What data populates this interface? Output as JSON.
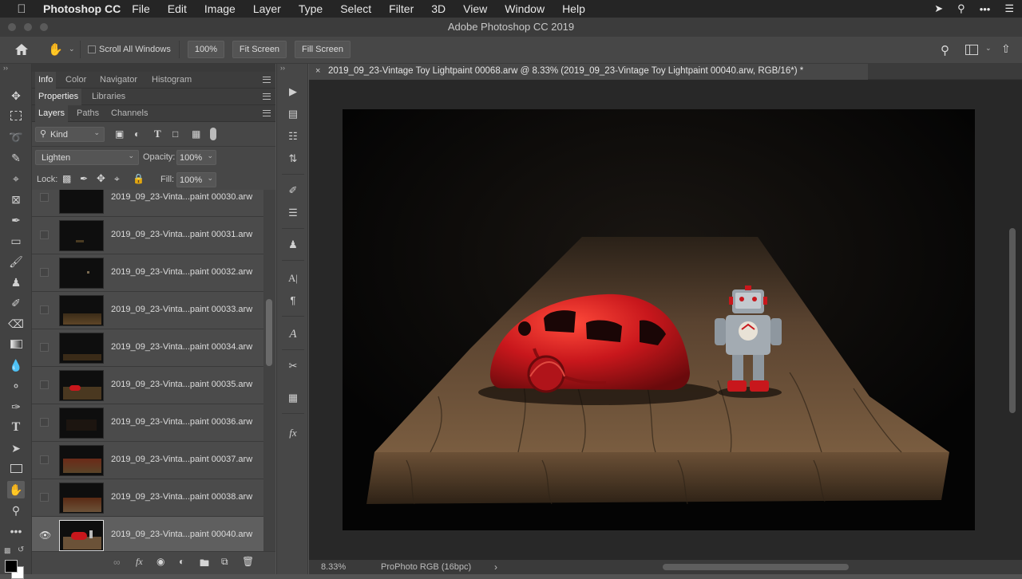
{
  "menubar": {
    "app_name": "Photoshop CC",
    "items": [
      "File",
      "Edit",
      "Image",
      "Layer",
      "Type",
      "Select",
      "Filter",
      "3D",
      "View",
      "Window",
      "Help"
    ]
  },
  "window": {
    "title": "Adobe Photoshop CC 2019"
  },
  "options_bar": {
    "scroll_all_windows": "Scroll All Windows",
    "zoom_value": "100%",
    "fit_screen": "Fit Screen",
    "fill_screen": "Fill Screen"
  },
  "panel_tabs": {
    "row1": [
      "Info",
      "Color",
      "Navigator",
      "Histogram"
    ],
    "row2": [
      "Properties",
      "Libraries"
    ],
    "row3": [
      "Layers",
      "Paths",
      "Channels"
    ]
  },
  "layers_panel": {
    "filter_kind": "Kind",
    "blend_mode": "Lighten",
    "opacity_label": "Opacity:",
    "opacity_value": "100%",
    "lock_label": "Lock:",
    "fill_label": "Fill:",
    "fill_value": "100%",
    "layers": [
      {
        "name": "2019_09_23-Vinta...paint 00030.arw",
        "visible": false,
        "selected": false
      },
      {
        "name": "2019_09_23-Vinta...paint 00031.arw",
        "visible": false,
        "selected": false
      },
      {
        "name": "2019_09_23-Vinta...paint 00032.arw",
        "visible": false,
        "selected": false
      },
      {
        "name": "2019_09_23-Vinta...paint 00033.arw",
        "visible": false,
        "selected": false
      },
      {
        "name": "2019_09_23-Vinta...paint 00034.arw",
        "visible": false,
        "selected": false
      },
      {
        "name": "2019_09_23-Vinta...paint 00035.arw",
        "visible": false,
        "selected": false
      },
      {
        "name": "2019_09_23-Vinta...paint 00036.arw",
        "visible": false,
        "selected": false
      },
      {
        "name": "2019_09_23-Vinta...paint 00037.arw",
        "visible": false,
        "selected": false
      },
      {
        "name": "2019_09_23-Vinta...paint 00038.arw",
        "visible": false,
        "selected": false
      },
      {
        "name": "2019_09_23-Vinta...paint 00040.arw",
        "visible": true,
        "selected": true
      }
    ]
  },
  "document": {
    "tab_title": "2019_09_23-Vintage Toy Lightpaint 00068.arw @ 8.33% (2019_09_23-Vintage Toy Lightpaint 00040.arw, RGB/16*) *",
    "zoom": "8.33%",
    "color_profile": "ProPhoto RGB (16bpc)"
  },
  "colors": {
    "accent_red": "#c8171c",
    "wood": "#6b5238"
  }
}
